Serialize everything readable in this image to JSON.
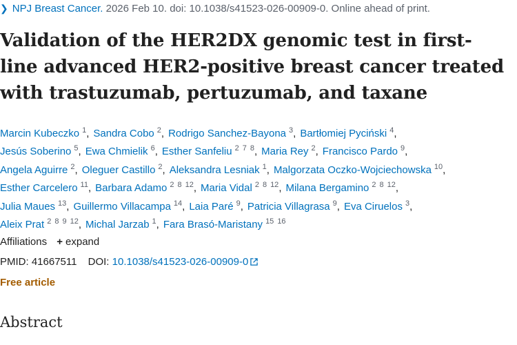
{
  "citation": {
    "journal": "NPJ Breast Cancer.",
    "details": "2026 Feb 10. doi: 10.1038/s41523-026-00909-0. Online ahead of print."
  },
  "title": "Validation of the HER2DX genomic test in first-line advanced HER2-positive breast cancer treated with trastuzumab, pertuzumab, and taxane",
  "author_lines": [
    [
      {
        "name": "Marcin Kubeczko",
        "affs": [
          "1"
        ]
      },
      {
        "name": "Sandra Cobo",
        "affs": [
          "2"
        ]
      },
      {
        "name": "Rodrigo Sanchez-Bayona",
        "affs": [
          "3"
        ]
      },
      {
        "name": "Bartłomiej Pyciński",
        "affs": [
          "4"
        ]
      }
    ],
    [
      {
        "name": "Jesús Soberino",
        "affs": [
          "5"
        ]
      },
      {
        "name": "Ewa Chmielik",
        "affs": [
          "6"
        ]
      },
      {
        "name": "Esther Sanfeliu",
        "affs": [
          "2",
          "7",
          "8"
        ]
      },
      {
        "name": "Maria Rey",
        "affs": [
          "2"
        ]
      },
      {
        "name": "Francisco Pardo",
        "affs": [
          "9"
        ]
      }
    ],
    [
      {
        "name": "Angela Aguirre",
        "affs": [
          "2"
        ]
      },
      {
        "name": "Oleguer Castillo",
        "affs": [
          "2"
        ]
      },
      {
        "name": "Aleksandra Lesniak",
        "affs": [
          "1"
        ]
      },
      {
        "name": "Malgorzata Oczko-Wojciechowska",
        "affs": [
          "10"
        ]
      }
    ],
    [
      {
        "name": "Esther Carcelero",
        "affs": [
          "11"
        ]
      },
      {
        "name": "Barbara Adamo",
        "affs": [
          "2",
          "8",
          "12"
        ]
      },
      {
        "name": "Maria Vidal",
        "affs": [
          "2",
          "8",
          "12"
        ]
      },
      {
        "name": "Milana Bergamino",
        "affs": [
          "2",
          "8",
          "12"
        ]
      }
    ],
    [
      {
        "name": "Julia Maues",
        "affs": [
          "13"
        ]
      },
      {
        "name": "Guillermo Villacampa",
        "affs": [
          "14"
        ]
      },
      {
        "name": "Laia Paré",
        "affs": [
          "9"
        ]
      },
      {
        "name": "Patricia Villagrasa",
        "affs": [
          "9"
        ]
      },
      {
        "name": "Eva Ciruelos",
        "affs": [
          "3"
        ]
      }
    ],
    [
      {
        "name": "Aleix Prat",
        "affs": [
          "2",
          "8",
          "9",
          "12"
        ]
      },
      {
        "name": "Michal Jarzab",
        "affs": [
          "1"
        ]
      },
      {
        "name": "Fara Brasó-Maristany",
        "affs": [
          "15",
          "16"
        ]
      }
    ]
  ],
  "affiliations": {
    "label": "Affiliations",
    "expand_label": "expand"
  },
  "identifiers": {
    "pmid_label": "PMID:",
    "pmid": "41667511",
    "doi_label": "DOI:",
    "doi": "10.1038/s41523-026-00909-0"
  },
  "free_label": "Free article",
  "abstract_heading": "Abstract",
  "colors": {
    "link": "#0071bc",
    "free_article": "#a35c00",
    "text": "#212121",
    "muted": "#5b616b"
  }
}
